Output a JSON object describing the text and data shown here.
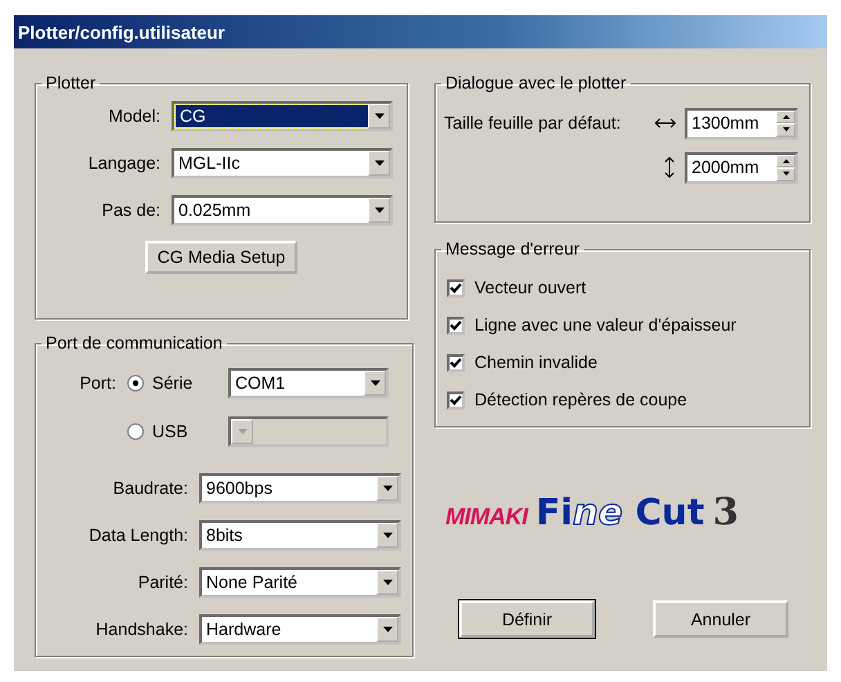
{
  "window": {
    "title": "Plotter/config.utilisateur"
  },
  "plotter": {
    "title": "Plotter",
    "fields": [
      {
        "label": "Model:",
        "value": "CG",
        "focused": true
      },
      {
        "label": "Langage:",
        "value": "MGL-IIc",
        "focused": false
      },
      {
        "label": "Pas de:",
        "value": "0.025mm",
        "focused": false
      }
    ],
    "button": "CG Media Setup"
  },
  "port": {
    "title": "Port de communication",
    "port_label": "Port:",
    "ports": [
      {
        "label": "Série",
        "selected": true,
        "value": "COM1",
        "disabled": false
      },
      {
        "label": "USB",
        "selected": false,
        "disabled": true
      }
    ],
    "fields": [
      {
        "label": "Baudrate:",
        "value": "9600bps",
        "focused": false
      },
      {
        "label": "Data Length:",
        "value": "8bits",
        "focused": false
      },
      {
        "label": "Parité:",
        "value": "None Parité",
        "focused": false
      },
      {
        "label": "Handshake:",
        "value": "Hardware",
        "focused": false
      }
    ]
  },
  "dialogue": {
    "title": "Dialogue avec le plotter",
    "size_label": "Taille feuille par défaut:",
    "sizes": [
      {
        "kind": "horizontal",
        "value": "1300mm"
      },
      {
        "kind": "vertical",
        "value": "2000mm"
      }
    ]
  },
  "errors": {
    "title": "Message d'erreur",
    "items": [
      {
        "label": "Vecteur ouvert",
        "checked": true
      },
      {
        "label": "Ligne avec une valeur d'épaisseur",
        "checked": true
      },
      {
        "label": "Chemin invalide",
        "checked": true
      },
      {
        "label": "Détection repères de coupe",
        "checked": true
      }
    ]
  },
  "logo": {
    "brand": "MIMAKI",
    "product_start": "Fi",
    "product_mid": "ne",
    "product_end": "Cut",
    "version": "3"
  },
  "buttons": [
    {
      "label": "Définir",
      "default": true
    },
    {
      "label": "Annuler",
      "default": false
    }
  ]
}
